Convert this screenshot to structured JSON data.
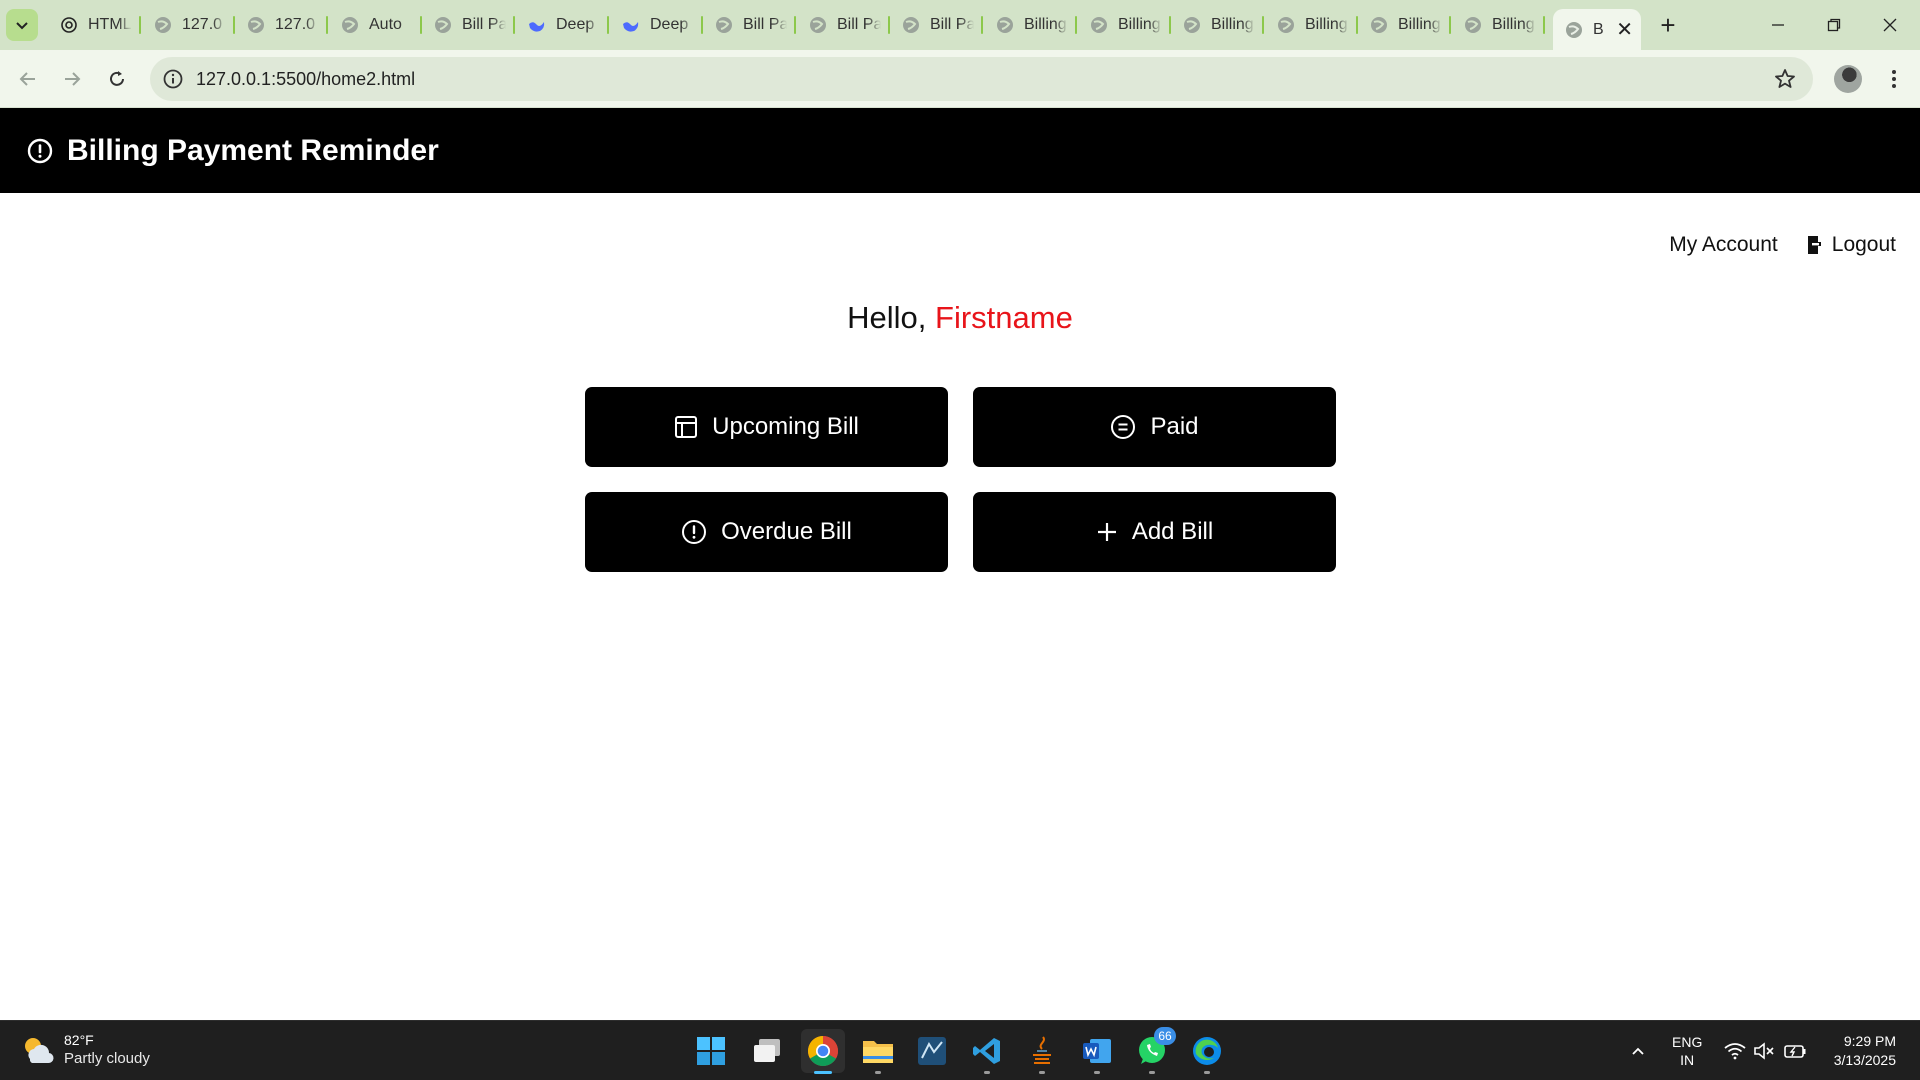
{
  "browser": {
    "tabs": [
      {
        "title": "HTML",
        "favicon": "chatgpt-icon"
      },
      {
        "title": "127.0",
        "favicon": "globe-icon"
      },
      {
        "title": "127.0",
        "favicon": "globe-icon"
      },
      {
        "title": "Auto",
        "favicon": "globe-icon"
      },
      {
        "title": "Bill Pa",
        "favicon": "globe-icon"
      },
      {
        "title": "Deep",
        "favicon": "deepseek-icon"
      },
      {
        "title": "Deep",
        "favicon": "deepseek-icon"
      },
      {
        "title": "Bill Pa",
        "favicon": "globe-icon"
      },
      {
        "title": "Bill Pa",
        "favicon": "globe-icon"
      },
      {
        "title": "Bill Pa",
        "favicon": "globe-icon"
      },
      {
        "title": "Billing",
        "favicon": "globe-icon"
      },
      {
        "title": "Billing",
        "favicon": "globe-icon"
      },
      {
        "title": "Billing",
        "favicon": "globe-icon"
      },
      {
        "title": "Billing",
        "favicon": "globe-icon"
      },
      {
        "title": "Billing",
        "favicon": "globe-icon"
      },
      {
        "title": "Billing",
        "favicon": "globe-icon"
      }
    ],
    "active_tab": {
      "title": "B",
      "close": "✕"
    },
    "new_tab": "+",
    "window_controls": {
      "minimize": "—",
      "restore": "❐",
      "close": "✕"
    },
    "url": "127.0.0.1:5500/home2.html",
    "accent": "#8cc84b"
  },
  "app": {
    "title": "Billing Payment Reminder",
    "nav": {
      "my_account": "My Account",
      "logout": "Logout"
    },
    "greeting": {
      "hello": "Hello, ",
      "name": "Firstname"
    },
    "buttons": {
      "upcoming": "Upcoming Bill",
      "paid": "Paid",
      "overdue": "Overdue Bill",
      "add": "Add Bill"
    },
    "colors": {
      "header_bg": "#000000",
      "name_accent": "#e8141a"
    }
  },
  "taskbar": {
    "weather": {
      "temp": "82°F",
      "condition": "Partly cloudy"
    },
    "whatsapp_badge": "66",
    "language": {
      "line1": "ENG",
      "line2": "IN"
    },
    "clock": {
      "time": "9:29 PM",
      "date": "3/13/2025"
    }
  }
}
